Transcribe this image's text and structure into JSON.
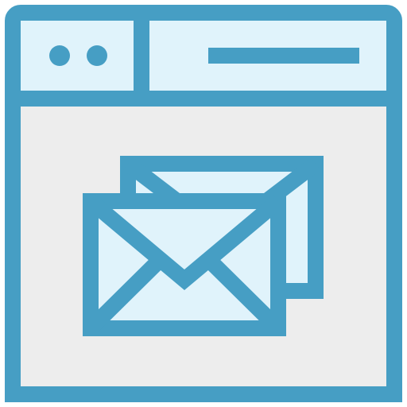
{
  "icon": {
    "name": "web-mail-icon",
    "parts": [
      "browser-window-icon",
      "envelope-back-icon",
      "envelope-front-icon"
    ]
  },
  "colors": {
    "stroke": "#469EC4",
    "header_fill": "#E0F3FB",
    "body_fill": "#EDEDED",
    "envelope_fill": "#E0F3FB"
  }
}
